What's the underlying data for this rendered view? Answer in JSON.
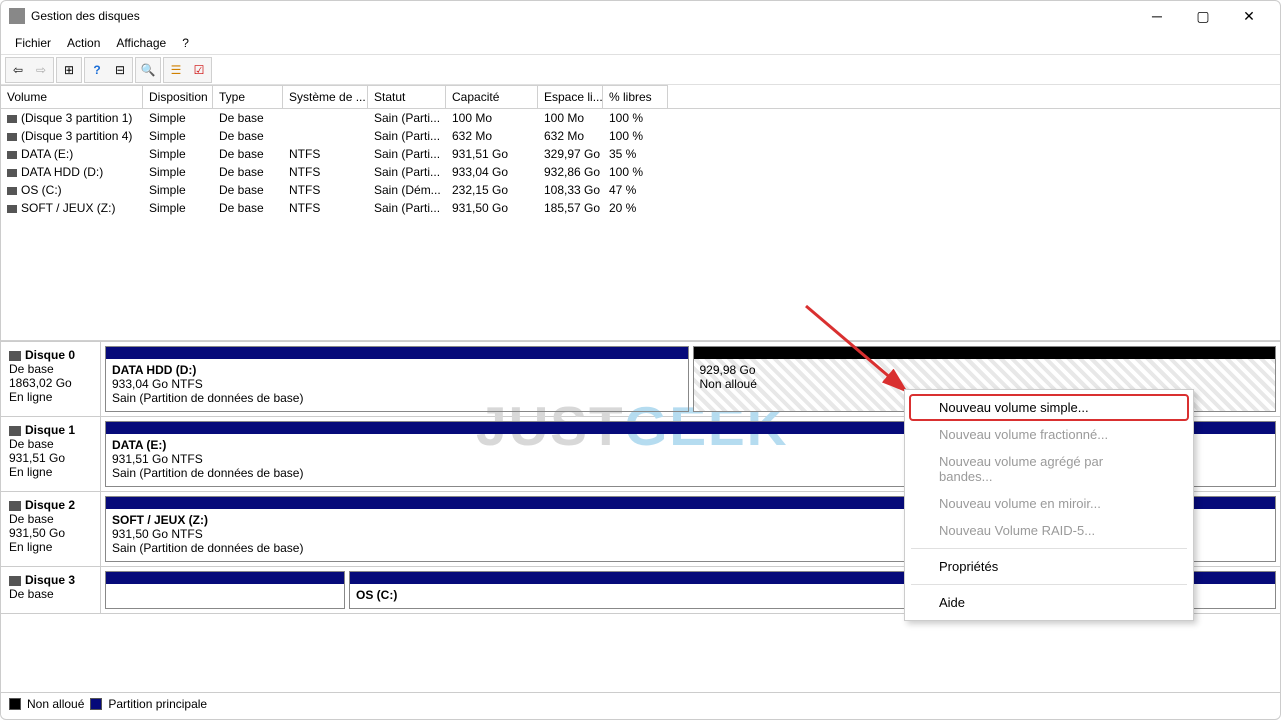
{
  "window": {
    "title": "Gestion des disques"
  },
  "menu": {
    "file": "Fichier",
    "action": "Action",
    "view": "Affichage",
    "help": "?"
  },
  "columns": [
    "Volume",
    "Disposition",
    "Type",
    "Système de ...",
    "Statut",
    "Capacité",
    "Espace li...",
    "% libres"
  ],
  "volumes": [
    {
      "name": "(Disque 3 partition 1)",
      "disp": "Simple",
      "type": "De base",
      "fs": "",
      "status": "Sain (Parti...",
      "cap": "100 Mo",
      "free": "100 Mo",
      "pct": "100 %"
    },
    {
      "name": "(Disque 3 partition 4)",
      "disp": "Simple",
      "type": "De base",
      "fs": "",
      "status": "Sain (Parti...",
      "cap": "632 Mo",
      "free": "632 Mo",
      "pct": "100 %"
    },
    {
      "name": "DATA (E:)",
      "disp": "Simple",
      "type": "De base",
      "fs": "NTFS",
      "status": "Sain (Parti...",
      "cap": "931,51 Go",
      "free": "329,97 Go",
      "pct": "35 %"
    },
    {
      "name": "DATA HDD (D:)",
      "disp": "Simple",
      "type": "De base",
      "fs": "NTFS",
      "status": "Sain (Parti...",
      "cap": "933,04 Go",
      "free": "932,86 Go",
      "pct": "100 %"
    },
    {
      "name": "OS (C:)",
      "disp": "Simple",
      "type": "De base",
      "fs": "NTFS",
      "status": "Sain (Dém...",
      "cap": "232,15 Go",
      "free": "108,33 Go",
      "pct": "47 %"
    },
    {
      "name": "SOFT / JEUX (Z:)",
      "disp": "Simple",
      "type": "De base",
      "fs": "NTFS",
      "status": "Sain (Parti...",
      "cap": "931,50 Go",
      "free": "185,57 Go",
      "pct": "20 %"
    }
  ],
  "disks": [
    {
      "name": "Disque 0",
      "type": "De base",
      "size": "1863,02 Go",
      "status": "En ligne",
      "parts": [
        {
          "title": "DATA HDD  (D:)",
          "sub": "933,04 Go NTFS",
          "detail": "Sain (Partition de données de base)",
          "stripe": "primary"
        },
        {
          "title": "",
          "sub": "929,98 Go",
          "detail": "Non alloué",
          "stripe": "unalloc",
          "hatched": true
        }
      ]
    },
    {
      "name": "Disque 1",
      "type": "De base",
      "size": "931,51 Go",
      "status": "En ligne",
      "parts": [
        {
          "title": "DATA  (E:)",
          "sub": "931,51 Go NTFS",
          "detail": "Sain (Partition de données de base)",
          "stripe": "primary"
        }
      ]
    },
    {
      "name": "Disque 2",
      "type": "De base",
      "size": "931,50 Go",
      "status": "En ligne",
      "parts": [
        {
          "title": "SOFT / JEUX  (Z:)",
          "sub": "931,50 Go NTFS",
          "detail": "Sain (Partition de données de base)",
          "stripe": "primary"
        }
      ]
    },
    {
      "name": "Disque 3",
      "type": "De base",
      "size": "",
      "status": "",
      "parts": [
        {
          "title": "",
          "sub": "",
          "detail": "",
          "stripe": "primary",
          "small": true
        },
        {
          "title": "OS  (C:)",
          "sub": "",
          "detail": "",
          "stripe": "primary"
        },
        {
          "title": "",
          "sub": "",
          "detail": "",
          "stripe": "primary",
          "small": true
        }
      ]
    }
  ],
  "contextMenu": {
    "newSimple": "Nouveau volume simple...",
    "newSpanned": "Nouveau volume fractionné...",
    "newStriped": "Nouveau volume agrégé par bandes...",
    "newMirror": "Nouveau volume en miroir...",
    "newRaid": "Nouveau Volume RAID-5...",
    "properties": "Propriétés",
    "help": "Aide"
  },
  "legend": {
    "unalloc": "Non alloué",
    "primary": "Partition principale"
  },
  "watermark": {
    "p1": "JUST",
    "p2": "GEEK"
  }
}
